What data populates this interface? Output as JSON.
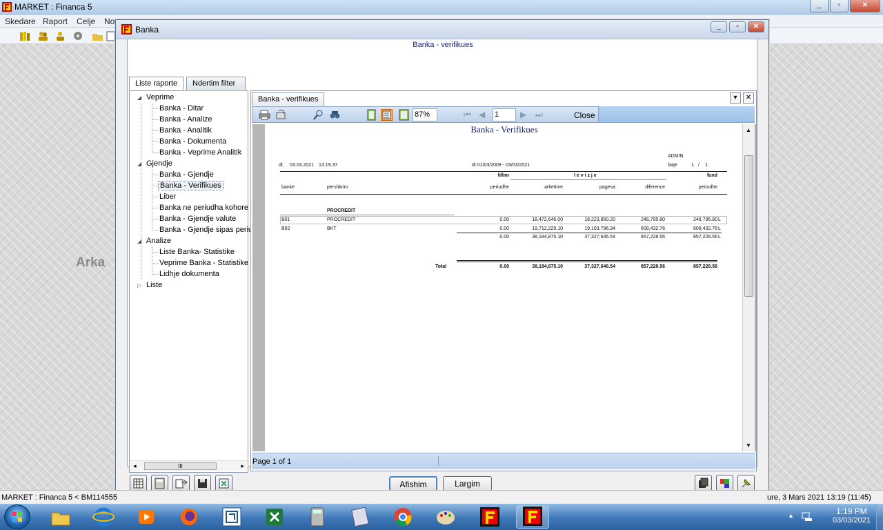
{
  "outer_window": {
    "title": "MARKET : Financa 5"
  },
  "menu": [
    "Skedare",
    "Raport",
    "Celje",
    "No"
  ],
  "background_label": "Arka",
  "banka_window": {
    "title": "Banka",
    "report_title": "Banka - verifikues",
    "tabs": [
      "Liste raporte",
      "Ndertim filter"
    ],
    "tree": {
      "groups": [
        {
          "label": "Veprime",
          "items": [
            "Banka - Ditar",
            "Banka - Analize",
            "Banka - Analitik",
            "Banka - Dokumenta",
            "Banka - Veprime Analitik"
          ]
        },
        {
          "label": "Gjendje",
          "items": [
            "Banka - Gjendje",
            "Banka - Verifikues",
            "Liber",
            "Banka ne periudha kohore",
            "Banka - Gjendje valute",
            "Banka - Gjendje sipas periu"
          ]
        },
        {
          "label": "Analize",
          "items": [
            "Liste Banka- Statistike",
            "Veprime Banka - Statistike",
            "Lidhje dokumenta"
          ]
        },
        {
          "label": "Liste",
          "items": []
        }
      ],
      "selected": "Banka - Verifikues",
      "hscroll_thumb": "III"
    },
    "doc_tab": "Banka - verifikues",
    "preview_toolbar": {
      "zoom": "87%",
      "page": "1",
      "close": "Close"
    },
    "status": "Page 1 of 1",
    "buttons": {
      "afishim": "Afishim",
      "largim": "Largim"
    }
  },
  "report": {
    "title": "Banka - Verifikues",
    "user": "ADMIN",
    "dt_label": "dt.",
    "date": "03.03.2021",
    "time": "13.19.37",
    "period": "dt 01/03/2009 - 03/03/2021",
    "faqe_label": "faqe",
    "page": "1",
    "slash": "/",
    "total_pages": "1",
    "hdr_top": {
      "fillim": "fillim",
      "levizje": "l e v i z j e",
      "fund": "fund"
    },
    "hdr": {
      "banke": "banke",
      "pershkrim": "pershkrim",
      "perudhe1": "periudhe",
      "arketime": "arketime",
      "pagesa": "pagesa",
      "diference": "diference",
      "perudhe2": "periudhe"
    },
    "group_label": "PROCREDIT",
    "rows": [
      {
        "code": "B01",
        "name": "PROCREDIT",
        "fillim": "0.00",
        "arketime": "18,472,646.00",
        "pagesa": "18,223,850.20",
        "diference": "248,795.80",
        "fund": "248,795.80",
        "flag": "L"
      },
      {
        "code": "B02",
        "name": "BKT",
        "fillim": "0.00",
        "arketime": "19,712,229.10",
        "pagesa": "19,103,796.34",
        "diference": "608,432.76",
        "fund": "608,432.76",
        "flag": "L"
      }
    ],
    "subtotal": {
      "fillim": "0.00",
      "arketime": "38,184,875.10",
      "pagesa": "37,327,646.54",
      "diference": "857,228.56",
      "fund": "857,228.56",
      "flag": "L"
    },
    "total": {
      "label": "Total",
      "fillim": "0.00",
      "arketime": "38,184,875.10",
      "pagesa": "37,327,646.54",
      "diference": "857,228.56",
      "fund": "857,228.56"
    }
  },
  "app_status": {
    "left": "MARKET : Financa 5  < BM114555",
    "right": "ure, 3 Mars 2021 13:19  (11:45)"
  },
  "taskbar": {
    "time": "1:19 PM",
    "date": "03/03/2021"
  },
  "colors": {
    "accent": "#1a237e",
    "taskbar": "#3e78b8"
  }
}
